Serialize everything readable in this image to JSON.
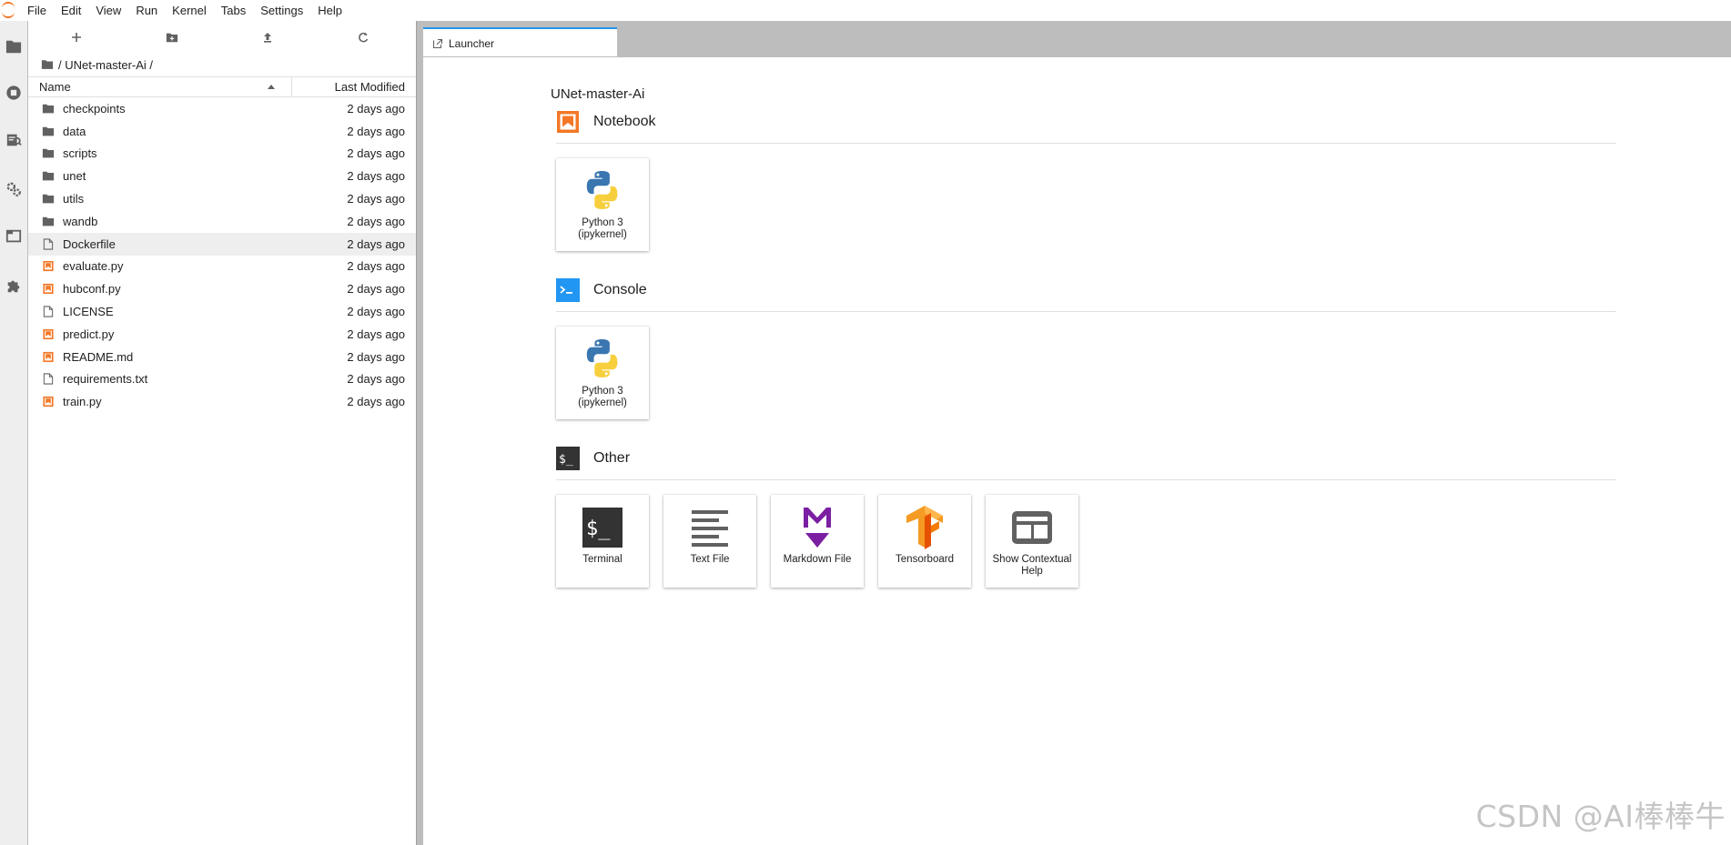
{
  "menu": [
    "File",
    "Edit",
    "View",
    "Run",
    "Kernel",
    "Tabs",
    "Settings",
    "Help"
  ],
  "activity_icons": [
    "folder-icon",
    "running-icon",
    "commands-icon",
    "property-inspector-icon",
    "tabs-icon",
    "extension-icon"
  ],
  "filebrowser": {
    "toolbar": [
      "new-launcher-icon",
      "new-folder-icon",
      "upload-icon",
      "refresh-icon"
    ],
    "breadcrumb": "/ UNet-master-Ai /",
    "col_name": "Name",
    "col_modified": "Last Modified",
    "items": [
      {
        "name": "checkpoints",
        "kind": "folder",
        "modified": "2 days ago"
      },
      {
        "name": "data",
        "kind": "folder",
        "modified": "2 days ago"
      },
      {
        "name": "scripts",
        "kind": "folder",
        "modified": "2 days ago"
      },
      {
        "name": "unet",
        "kind": "folder",
        "modified": "2 days ago"
      },
      {
        "name": "utils",
        "kind": "folder",
        "modified": "2 days ago"
      },
      {
        "name": "wandb",
        "kind": "folder",
        "modified": "2 days ago"
      },
      {
        "name": "Dockerfile",
        "kind": "file",
        "modified": "2 days ago",
        "selected": true
      },
      {
        "name": "evaluate.py",
        "kind": "notebook",
        "modified": "2 days ago"
      },
      {
        "name": "hubconf.py",
        "kind": "notebook",
        "modified": "2 days ago"
      },
      {
        "name": "LICENSE",
        "kind": "file",
        "modified": "2 days ago"
      },
      {
        "name": "predict.py",
        "kind": "notebook",
        "modified": "2 days ago"
      },
      {
        "name": "README.md",
        "kind": "notebook",
        "modified": "2 days ago"
      },
      {
        "name": "requirements.txt",
        "kind": "file",
        "modified": "2 days ago"
      },
      {
        "name": "train.py",
        "kind": "notebook",
        "modified": "2 days ago"
      }
    ]
  },
  "tab": {
    "label": "Launcher"
  },
  "launcher": {
    "title": "UNet-master-Ai",
    "sections": [
      {
        "title": "Notebook",
        "cards": [
          {
            "label": "Python 3 (ipykernel)",
            "icon": "python-icon"
          }
        ]
      },
      {
        "title": "Console",
        "cards": [
          {
            "label": "Python 3 (ipykernel)",
            "icon": "python-icon"
          }
        ]
      },
      {
        "title": "Other",
        "cards": [
          {
            "label": "Terminal",
            "icon": "terminal-icon"
          },
          {
            "label": "Text File",
            "icon": "text-file-icon"
          },
          {
            "label": "Markdown File",
            "icon": "markdown-icon"
          },
          {
            "label": "Tensorboard",
            "icon": "tensorboard-icon"
          },
          {
            "label": "Show Contextual Help",
            "icon": "contextual-help-icon"
          }
        ]
      }
    ]
  },
  "watermark": "CSDN @AI棒棒牛",
  "colors": {
    "accent": "#2196f3",
    "orange": "#f37726",
    "icon_gray": "#616161"
  }
}
